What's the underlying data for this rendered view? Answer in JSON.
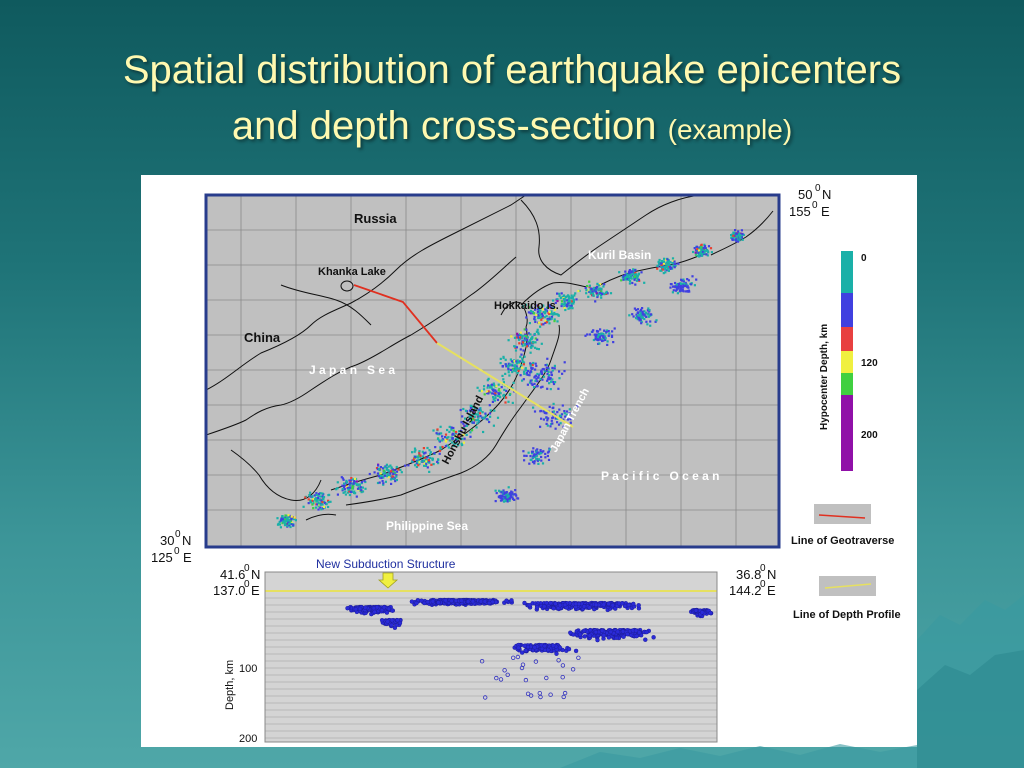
{
  "title": {
    "line1": "Spatial distribution of earthquake epicenters",
    "line2": "and depth cross-section",
    "suffix": "(example)"
  },
  "map": {
    "corner_ne": {
      "lat_deg": "50",
      "lat_min": "0",
      "lat_hemi": "N",
      "lon_deg": "155",
      "lon_min": "0",
      "lon_hemi": "E"
    },
    "corner_sw": {
      "lat_deg": "30",
      "lat_min": "0",
      "lat_hemi": "N",
      "lon_deg": "125",
      "lon_min": "0",
      "lon_hemi": "E"
    },
    "labels": {
      "russia": "Russia",
      "khanka": "Khanka Lake",
      "china": "China",
      "japan_sea": "J a p a n   S e a",
      "kuril": "Kuril Basin",
      "hokkaido": "Hokkaido Is.",
      "honshu": "Honshu Island",
      "trench": "Japan Trench",
      "pacific": "P a c i f i c   O c e a n",
      "philippine": "Philippine Sea"
    },
    "colors": {
      "ocean": "#c0c0c0",
      "frame": "#283c8c",
      "cyan": "#1ab0a8",
      "blue": "#4040e0",
      "red": "#e84030",
      "yellow": "#f0f040",
      "green": "#40d040",
      "purple": "#9010a8"
    }
  },
  "legend": {
    "axis_title": "Hypocenter Depth, km",
    "ticks": [
      "0",
      "120",
      "200"
    ],
    "geotraverse": "Line of Geotraverse",
    "depth_profile": "Line of Depth Profile"
  },
  "profile": {
    "annotation": "New Subduction Structure",
    "left": {
      "lat_deg": "41.6",
      "lat_min": "0",
      "lat_hemi": "N",
      "lon": "137.0",
      "lon_min": "0",
      "lon_hemi": "E"
    },
    "right": {
      "lat_deg": "36.8",
      "lat_min": "0",
      "lat_hemi": "N",
      "lon": "144.2",
      "lon_min": "0",
      "lon_hemi": "E"
    },
    "ylabel": "Depth, km",
    "yticks": [
      "100",
      "200"
    ]
  }
}
